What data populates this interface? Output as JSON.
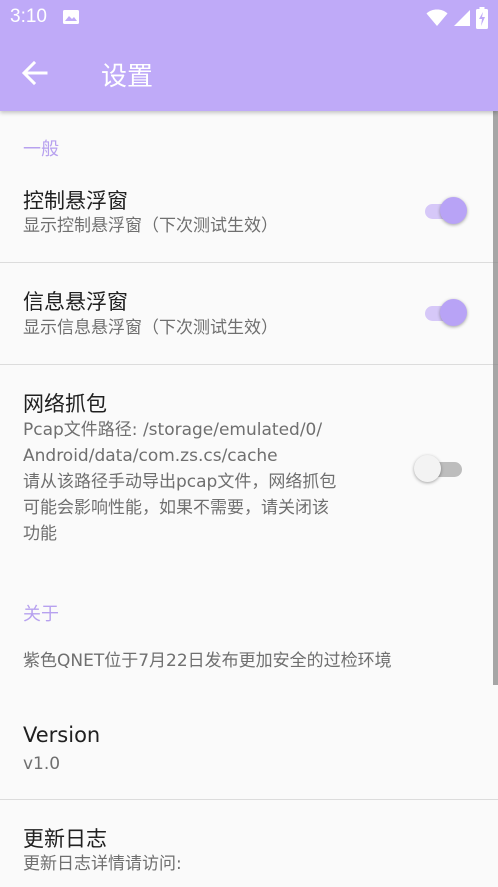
{
  "status_bar": {
    "time": "3:10",
    "icons": [
      "photo-icon",
      "wifi-icon",
      "signal-icon",
      "battery-charging-icon"
    ]
  },
  "app_bar": {
    "back_icon": "arrow-back-icon",
    "title": "设置"
  },
  "sections": {
    "general": {
      "header": "一般",
      "prefs": {
        "control_float": {
          "title": "控制悬浮窗",
          "summary": "显示控制悬浮窗（下次测试生效）",
          "enabled": true
        },
        "info_float": {
          "title": "信息悬浮窗",
          "summary": "显示信息悬浮窗（下次测试生效）",
          "enabled": true
        },
        "packet_capture": {
          "title": "网络抓包",
          "summary_lines": [
            "Pcap文件路径: /storage/emulated/0/",
            "Android/data/com.zs.cs/cache",
            "请从该路径手动导出pcap文件，网络抓包",
            "可能会影响性能，如果不需要，请关闭该",
            "功能"
          ],
          "enabled": false
        }
      }
    },
    "about": {
      "header": "关于",
      "description": "紫色QNET位于7月22日发布更加安全的过检环境",
      "version": {
        "title": "Version",
        "value": "v1.0"
      },
      "changelog": {
        "title": "更新日志",
        "summary": "更新日志详情请访问:"
      }
    }
  },
  "colors": {
    "app_bar": "#bfaaf8",
    "accent": "#b8a3f6",
    "section_header": "#b7a1ef"
  }
}
